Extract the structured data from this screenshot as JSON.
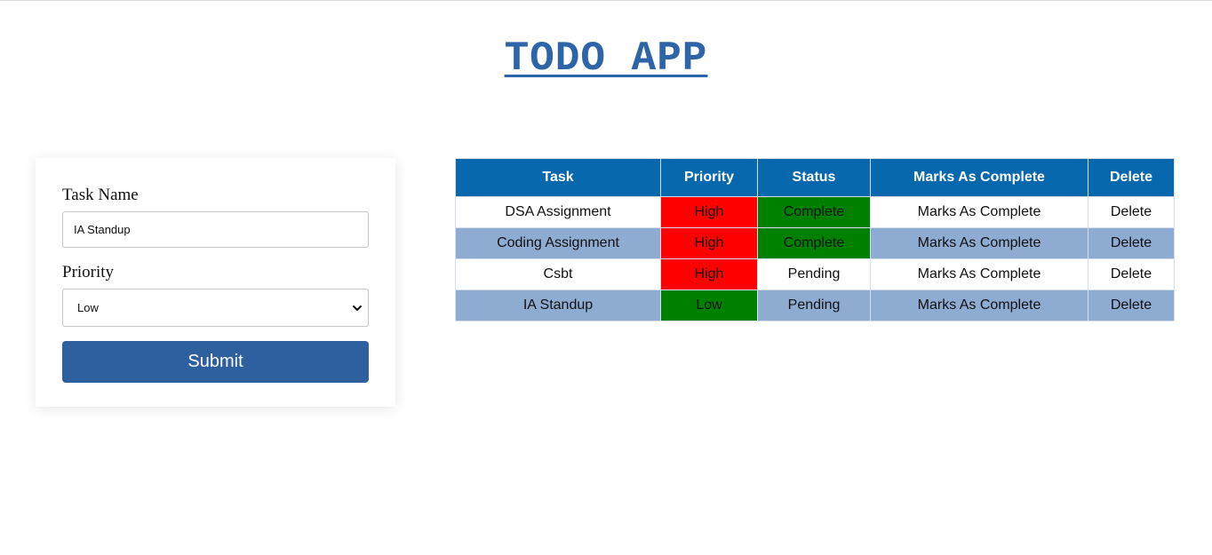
{
  "app": {
    "title": "TODO APP"
  },
  "form": {
    "task_name_label": "Task Name",
    "task_name_value": "IA Standup",
    "priority_label": "Priority",
    "priority_selected": "Low",
    "submit_label": "Submit"
  },
  "table": {
    "headers": [
      "Task",
      "Priority",
      "Status",
      "Marks As Complete",
      "Delete"
    ],
    "rows": [
      {
        "task": "DSA Assignment",
        "priority": "High",
        "status": "Complete",
        "mark": "Marks As Complete",
        "delete": "Delete"
      },
      {
        "task": "Coding Assignment",
        "priority": "High",
        "status": "Complete",
        "mark": "Marks As Complete",
        "delete": "Delete"
      },
      {
        "task": "Csbt",
        "priority": "High",
        "status": "Pending",
        "mark": "Marks As Complete",
        "delete": "Delete"
      },
      {
        "task": "IA Standup",
        "priority": "Low",
        "status": "Pending",
        "mark": "Marks As Complete",
        "delete": "Delete"
      }
    ]
  },
  "colors": {
    "title": "#2e64a8",
    "header_bg": "#0768ad",
    "alt_row_bg": "#8eabd2",
    "priority_high": "#ff0000",
    "priority_low": "#008000",
    "status_complete": "#008000",
    "submit_bg": "#2e5f9e"
  },
  "icons": {
    "select_arrow": "chevron-down-icon"
  }
}
